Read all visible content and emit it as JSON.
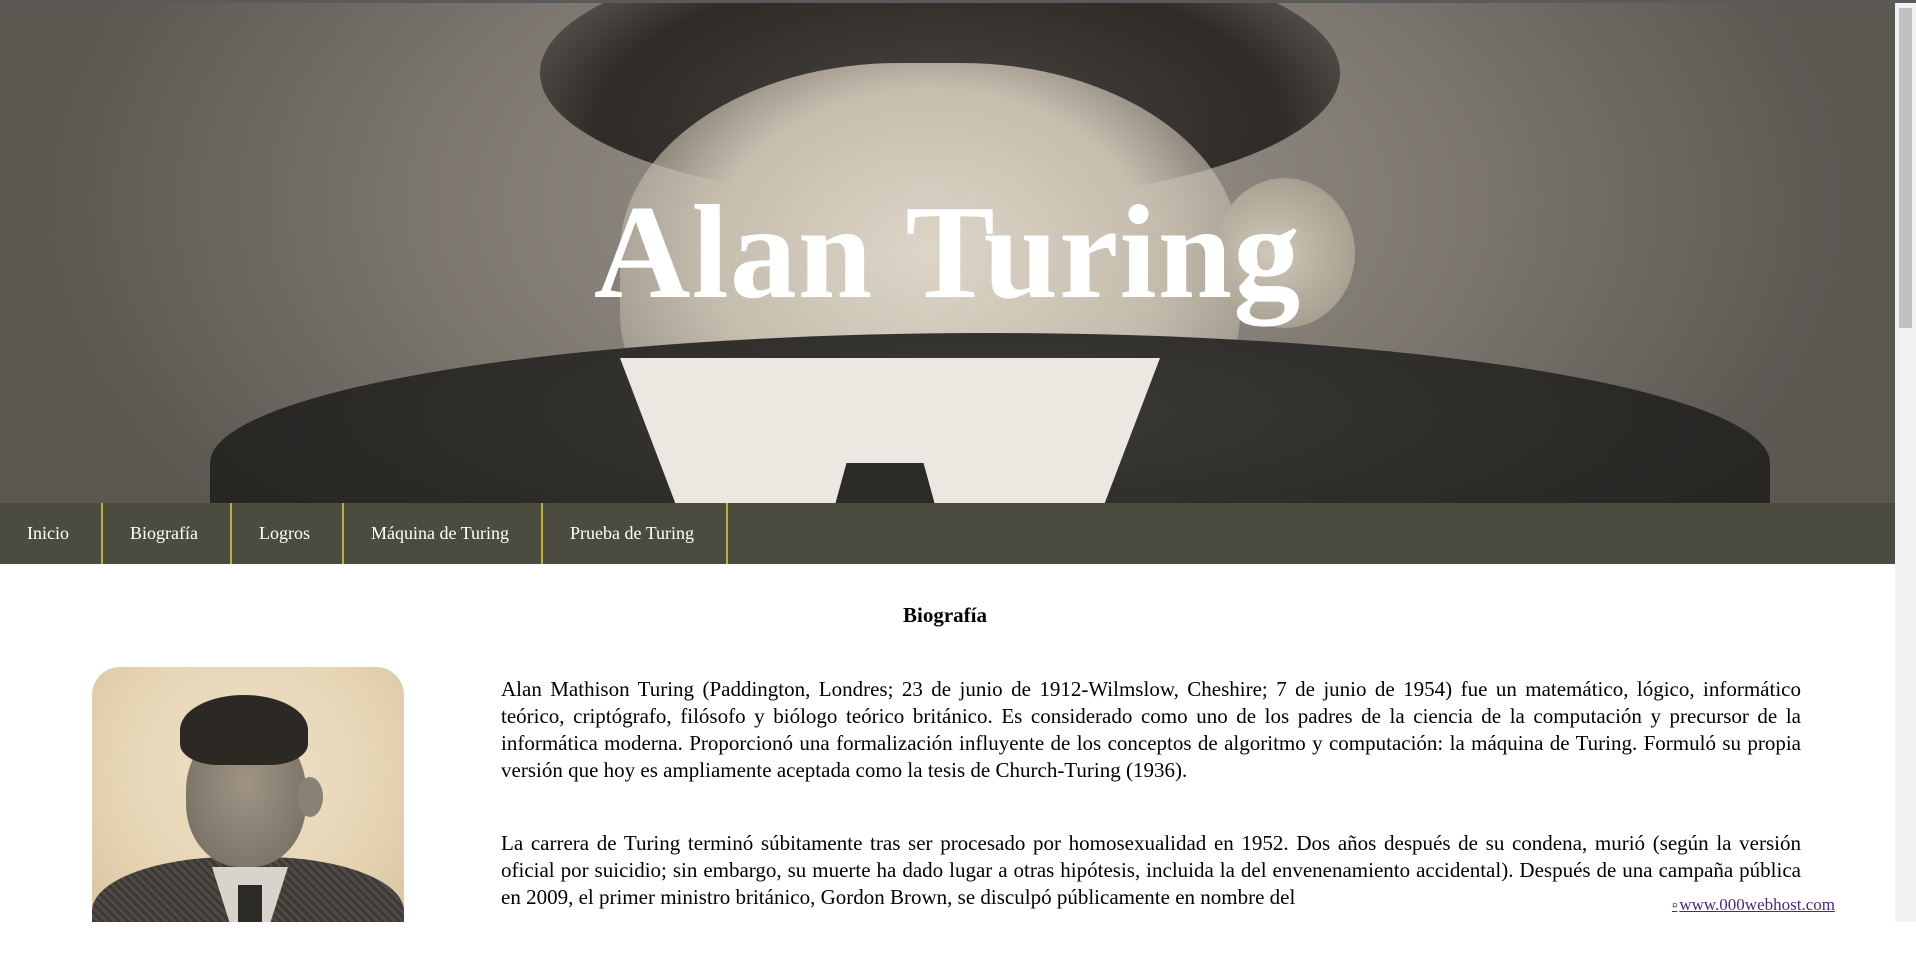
{
  "hero": {
    "title": "Alan Turing"
  },
  "nav": {
    "items": [
      {
        "label": "Inicio"
      },
      {
        "label": "Biografía"
      },
      {
        "label": "Logros"
      },
      {
        "label": "Máquina de Turing"
      },
      {
        "label": "Prueba de Turing"
      }
    ]
  },
  "main": {
    "section_title": "Biografía",
    "paragraphs": [
      "Alan Mathison Turing (Paddington, Londres; 23 de junio de 1912-Wilmslow, Cheshire; 7 de junio de 1954) fue un matemático, lógico, informático teórico, criptógrafo, filósofo y biólogo teórico británico. Es considerado como uno de los padres de la ciencia de la computación y precursor de la informática moderna. Proporcionó una formalización influyente de los conceptos de algoritmo y computación: la máquina de Turing. Formuló su propia versión que hoy es ampliamente aceptada como la tesis de Church-Turing (1936).",
      "La carrera de Turing terminó súbitamente tras ser procesado por homosexualidad en 1952. Dos años después de su condena, murió (según la versión oficial por suicidio; sin embargo, su muerte ha dado lugar a otras hipótesis, incluida la del envenenamiento accidental). Después de una campaña pública en 2009, el primer ministro británico, Gordon Brown, se disculpó públicamente en nombre del"
    ]
  },
  "footer_badge": {
    "link_text": "www.000webhost.com"
  },
  "colors": {
    "nav_background": "#4b4b40",
    "nav_divider": "#b9b13c",
    "hero_title": "#ffffff"
  }
}
